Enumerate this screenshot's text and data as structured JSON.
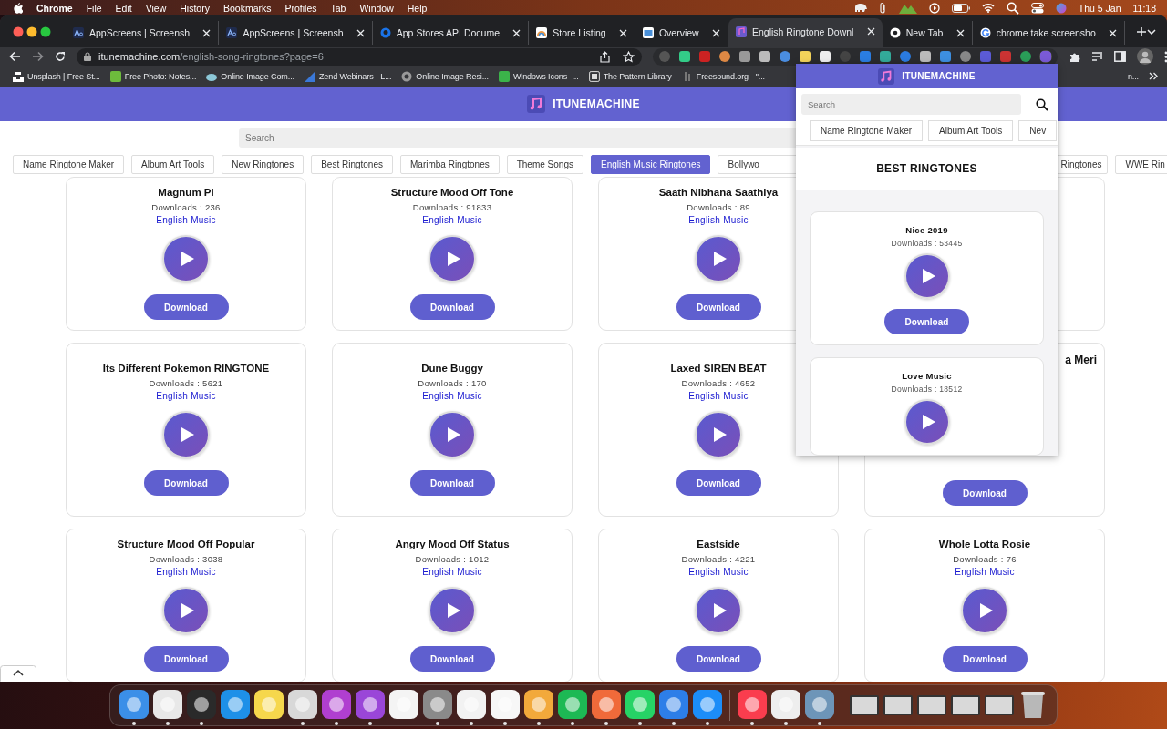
{
  "menu_bar": {
    "app": "Chrome",
    "menus": [
      "File",
      "Edit",
      "View",
      "History",
      "Bookmarks",
      "Profiles",
      "Tab",
      "Window",
      "Help"
    ],
    "date": "Thu 5 Jan",
    "time": "11:18"
  },
  "tabs": [
    {
      "title": "AppScreens | Screensh",
      "kind": "appscreens",
      "selected": false
    },
    {
      "title": "AppScreens | Screensh",
      "kind": "appscreens",
      "selected": false
    },
    {
      "title": "App Stores API Docume",
      "kind": "rapid",
      "selected": false
    },
    {
      "title": "Store Listing",
      "kind": "store",
      "selected": false
    },
    {
      "title": "Overview",
      "kind": "overview",
      "selected": false
    },
    {
      "title": "English Ringtone Downl",
      "kind": "itune",
      "selected": true
    },
    {
      "title": "New Tab",
      "kind": "chrome",
      "selected": false
    },
    {
      "title": "chrome take screensho",
      "kind": "google",
      "selected": false
    }
  ],
  "address_bar": {
    "domain": "itunemachine.com",
    "path": "/english-song-ringtones?page=6"
  },
  "bookmarks": [
    {
      "label": "Unsplash | Free St...",
      "kind": "unsplash"
    },
    {
      "label": "Free Photo: Notes...",
      "kind": "px"
    },
    {
      "label": "Online Image Com...",
      "kind": "cloud"
    },
    {
      "label": "Zend Webinars - L...",
      "kind": "zend"
    },
    {
      "label": "Online Image Resi...",
      "kind": "globe"
    },
    {
      "label": "Windows Icons -...",
      "kind": "green"
    },
    {
      "label": "The Pattern Library",
      "kind": "grid"
    },
    {
      "label": "Freesound.org - \"...",
      "kind": "freesound"
    },
    {
      "label": "n...",
      "kind": "tail"
    }
  ],
  "site": {
    "logo": "ITUNEMACHINE",
    "search_placeholder": "Search",
    "nav": [
      {
        "label": "Name Ringtone Maker",
        "kind": "full",
        "selected": false
      },
      {
        "label": "Album Art Tools",
        "kind": "full",
        "selected": false
      },
      {
        "label": "New Ringtones",
        "kind": "full",
        "selected": false
      },
      {
        "label": "Best Ringtones",
        "kind": "full",
        "selected": false
      },
      {
        "label": "Marimba Ringtones",
        "kind": "full",
        "selected": false
      },
      {
        "label": "Theme Songs",
        "kind": "full",
        "selected": false
      },
      {
        "label": "English Music Ringtones",
        "kind": "full",
        "selected": true
      },
      {
        "label": "Bollywo",
        "kind": "cut-end",
        "selected": false
      },
      {
        "label": "Ringtones",
        "kind": "cut-start",
        "selected": false
      },
      {
        "label": "WWE Rin",
        "kind": "full",
        "selected": false
      }
    ],
    "cards": [
      {
        "kind": "full",
        "title": "Magnum Pi",
        "downloads": "Downloads : 236",
        "category": "English Music",
        "button": "Download"
      },
      {
        "kind": "full",
        "title": "Structure Mood Off Tone",
        "downloads": "Downloads : 91833",
        "category": "English Music",
        "button": "Download"
      },
      {
        "kind": "full",
        "title": "Saath Nibhana Saathiya",
        "downloads": "Downloads : 89",
        "category": "English Music",
        "button": "Download"
      },
      {
        "kind": "hidden"
      },
      {
        "kind": "full",
        "title": "Its Different Pokemon RINGTONE",
        "downloads": "Downloads : 5621",
        "category": "English Music",
        "button": "Download"
      },
      {
        "kind": "full",
        "title": "Dune Buggy",
        "downloads": "Downloads : 170",
        "category": "English Music",
        "button": "Download"
      },
      {
        "kind": "full",
        "title": "Laxed SIREN BEAT",
        "downloads": "Downloads : 4652",
        "category": "English Music",
        "button": "Download"
      },
      {
        "kind": "partial",
        "title": "a Meri",
        "button": "Download"
      },
      {
        "kind": "full",
        "title": "Structure Mood Off Popular",
        "downloads": "Downloads : 3038",
        "category": "English Music",
        "button": "Download"
      },
      {
        "kind": "full",
        "title": "Angry Mood Off Status",
        "downloads": "Downloads : 1012",
        "category": "English Music",
        "button": "Download"
      },
      {
        "kind": "full",
        "title": "Eastside",
        "downloads": "Downloads : 4221",
        "category": "English Music",
        "button": "Download"
      },
      {
        "kind": "full",
        "title": "Whole Lotta Rosie",
        "downloads": "Downloads : 76",
        "category": "English Music",
        "button": "Download"
      }
    ]
  },
  "popup": {
    "logo": "ITUNEMACHINE",
    "search_placeholder": "Search",
    "nav": [
      {
        "label": "Name Ringtone Maker",
        "selected": false
      },
      {
        "label": "Album Art Tools",
        "selected": false
      },
      {
        "label": "Nev",
        "selected": false
      }
    ],
    "heading": "BEST RINGTONES",
    "cards": [
      {
        "title": "Nice 2019",
        "downloads": "Downloads : 53445",
        "button": "Download"
      },
      {
        "title": "Love Music",
        "downloads": "Downloads : 18512"
      }
    ]
  },
  "dock": {
    "apps": [
      {
        "kind": "finder",
        "running": true
      },
      {
        "kind": "chrome",
        "running": true
      },
      {
        "kind": "terminal",
        "running": true
      },
      {
        "kind": "migrate",
        "running": false
      },
      {
        "kind": "notes",
        "running": false
      },
      {
        "kind": "disk",
        "running": true
      },
      {
        "kind": "phpstorm",
        "running": true
      },
      {
        "kind": "podcasts",
        "running": true
      },
      {
        "kind": "frame",
        "running": false
      },
      {
        "kind": "settings",
        "running": true
      },
      {
        "kind": "xcode",
        "running": true
      },
      {
        "kind": "slack",
        "running": true
      },
      {
        "kind": "tableplus",
        "running": true
      },
      {
        "kind": "spotify",
        "running": true
      },
      {
        "kind": "pen",
        "running": true
      },
      {
        "kind": "whatsapp",
        "running": true
      },
      {
        "kind": "tools",
        "running": true
      },
      {
        "kind": "appstore",
        "running": true
      },
      {
        "kind": "sep"
      },
      {
        "kind": "music",
        "running": true
      },
      {
        "kind": "textedit",
        "running": true
      },
      {
        "kind": "preview",
        "running": true
      },
      {
        "kind": "sep"
      },
      {
        "kind": "window",
        "running": false
      },
      {
        "kind": "window",
        "running": false
      },
      {
        "kind": "window",
        "running": false
      },
      {
        "kind": "window",
        "running": false
      },
      {
        "kind": "window",
        "running": false
      },
      {
        "kind": "trash",
        "running": false
      }
    ]
  }
}
